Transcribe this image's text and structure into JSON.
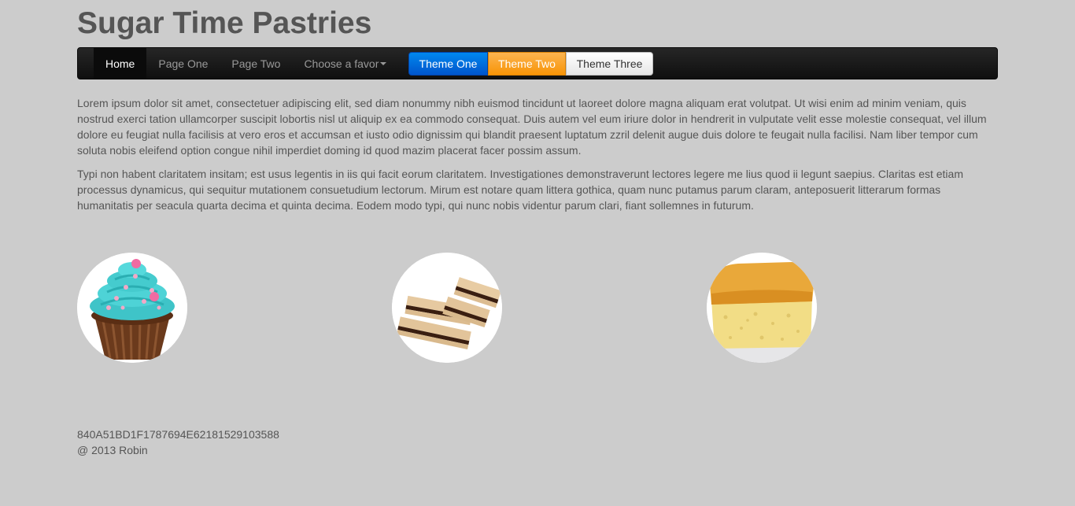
{
  "site": {
    "title": "Sugar Time Pastries"
  },
  "navbar": {
    "items": [
      {
        "label": "Home",
        "active": true
      },
      {
        "label": "Page One"
      },
      {
        "label": "Page Two"
      },
      {
        "label": "Choose a favor"
      }
    ],
    "themes": [
      {
        "label": "Theme One",
        "color": "#0066dd"
      },
      {
        "label": "Theme Two",
        "color": "#f89406"
      },
      {
        "label": "Theme Three",
        "color": "#ffffff"
      }
    ]
  },
  "content": {
    "paragraph1": "Lorem ipsum dolor sit amet, consectetuer adipiscing elit, sed diam nonummy nibh euismod tincidunt ut laoreet dolore magna aliquam erat volutpat. Ut wisi enim ad minim veniam, quis nostrud exerci tation ullamcorper suscipit lobortis nisl ut aliquip ex ea commodo consequat. Duis autem vel eum iriure dolor in hendrerit in vulputate velit esse molestie consequat, vel illum dolore eu feugiat nulla facilisis at vero eros et accumsan et iusto odio dignissim qui blandit praesent luptatum zzril delenit augue duis dolore te feugait nulla facilisi. Nam liber tempor cum soluta nobis eleifend option congue nihil imperdiet doming id quod mazim placerat facer possim assum.",
    "paragraph2": "Typi non habent claritatem insitam; est usus legentis in iis qui facit eorum claritatem. Investigationes demonstraverunt lectores legere me lius quod ii legunt saepius. Claritas est etiam processus dynamicus, qui sequitur mutationem consuetudium lectorum. Mirum est notare quam littera gothica, quam nunc putamus parum claram, anteposuerit litterarum formas humanitatis per seacula quarta decima et quinta decima. Eodem modo typi, qui nunc nobis videntur parum clari, fiant sollemnes in futurum."
  },
  "pastries": [
    {
      "icon": "cupcake-icon"
    },
    {
      "icon": "wafer-icon"
    },
    {
      "icon": "sponge-cake-icon"
    }
  ],
  "footer": {
    "hash": "840A51BD1F1787694E62181529103588",
    "copyright": "@ 2013 Robin"
  }
}
